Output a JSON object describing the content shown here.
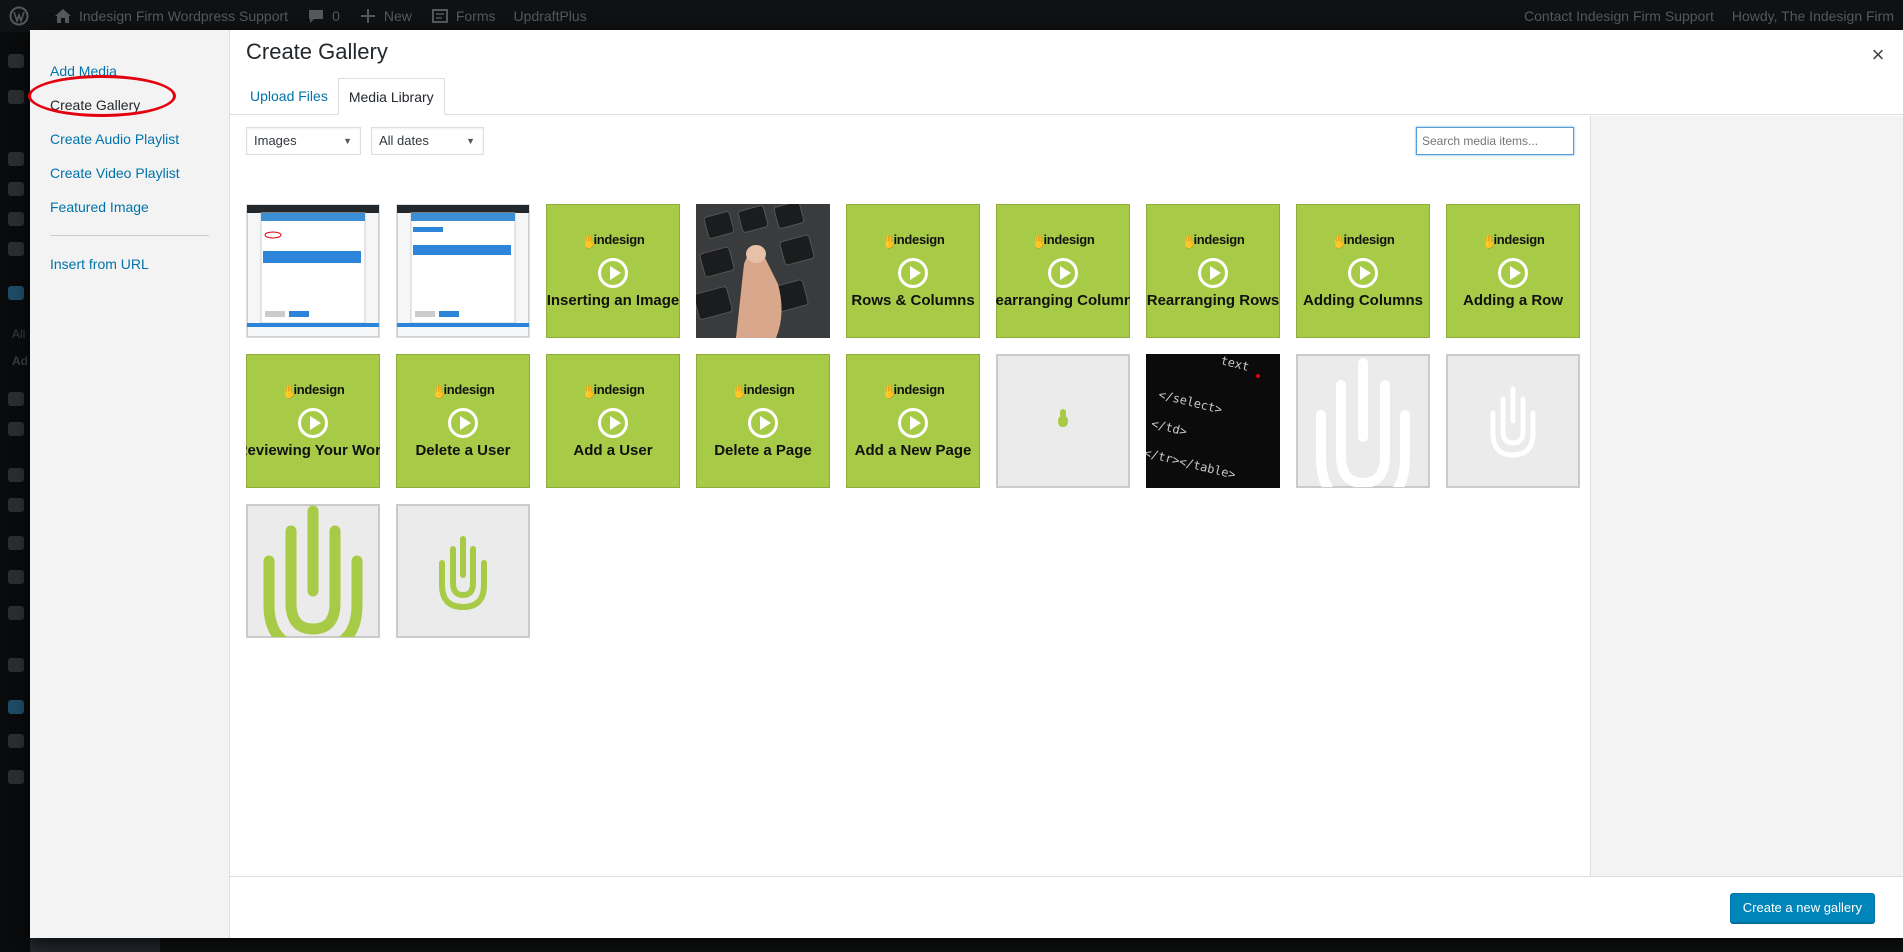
{
  "adminbar": {
    "site_name": "Indesign Firm Wordpress Support",
    "comments_count": "0",
    "new_label": "New",
    "forms_label": "Forms",
    "updraft_label": "UpdraftPlus",
    "contact_label": "Contact Indesign Firm Support",
    "howdy_label": "Howdy, The Indesign Firm"
  },
  "sidemenu": {
    "item_all": "All",
    "item_add": "Ad"
  },
  "menu": {
    "items": [
      {
        "label": "Add Media"
      },
      {
        "label": "Create Gallery"
      },
      {
        "label": "Create Audio Playlist"
      },
      {
        "label": "Create Video Playlist"
      },
      {
        "label": "Featured Image"
      },
      {
        "label": "Insert from URL"
      }
    ],
    "active": "Create Gallery"
  },
  "frame": {
    "title": "Create Gallery",
    "close_glyph": "×"
  },
  "router": {
    "tabs": [
      {
        "label": "Upload Files"
      },
      {
        "label": "Media Library"
      }
    ],
    "active": "Media Library"
  },
  "filters": {
    "type": "Images",
    "date": "All dates",
    "search_placeholder": "Search media items..."
  },
  "attachments": [
    {
      "kind": "screenshot"
    },
    {
      "kind": "screenshot"
    },
    {
      "kind": "video",
      "brand": "indesign",
      "title": "Inserting an Image"
    },
    {
      "kind": "keyboard"
    },
    {
      "kind": "video",
      "brand": "indesign",
      "title": "Rows & Columns"
    },
    {
      "kind": "video",
      "brand": "indesign",
      "title": "Rearranging Columns"
    },
    {
      "kind": "video",
      "brand": "indesign",
      "title": "Rearranging Rows"
    },
    {
      "kind": "video",
      "brand": "indesign",
      "title": "Adding Columns"
    },
    {
      "kind": "video",
      "brand": "indesign",
      "title": "Adding a Row"
    },
    {
      "kind": "video",
      "brand": "indesign",
      "title": "Reviewing Your Work"
    },
    {
      "kind": "video",
      "brand": "indesign",
      "title": "Delete a User"
    },
    {
      "kind": "video",
      "brand": "indesign",
      "title": "Add a User"
    },
    {
      "kind": "video",
      "brand": "indesign",
      "title": "Delete a Page"
    },
    {
      "kind": "video",
      "brand": "indesign",
      "title": "Add a New Page"
    },
    {
      "kind": "logo-small"
    },
    {
      "kind": "code"
    },
    {
      "kind": "logo-white-large"
    },
    {
      "kind": "logo-white-small"
    },
    {
      "kind": "logo-green-large"
    },
    {
      "kind": "logo-green-small"
    }
  ],
  "code_snippet": {
    "line1": "text",
    "line2": "</select>",
    "line3": "</td>",
    "line4": "</tr></table>"
  },
  "footer": {
    "primary_label": "Create a new gallery"
  },
  "colors": {
    "accent": "#0073aa",
    "brand_green": "#a8cb47",
    "highlight": "#e3000f"
  }
}
